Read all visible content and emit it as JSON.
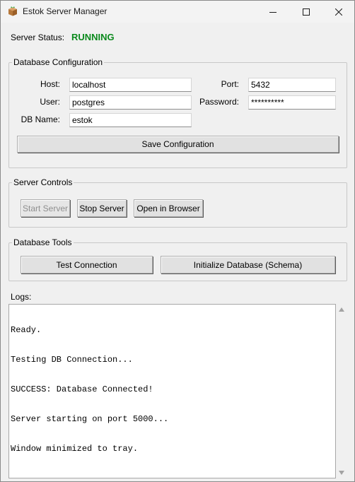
{
  "window": {
    "title": "Estok Server Manager",
    "icon": "box-package-icon"
  },
  "status": {
    "label": "Server Status:",
    "value": "RUNNING",
    "color": "#0b8a1d"
  },
  "db_config": {
    "title": "Database Configuration",
    "host_label": "Host:",
    "host_value": "localhost",
    "port_label": "Port:",
    "port_value": "5432",
    "user_label": "User:",
    "user_value": "postgres",
    "password_label": "Password:",
    "password_value": "**********",
    "dbname_label": "DB Name:",
    "dbname_value": "estok",
    "save_label": "Save Configuration"
  },
  "server_controls": {
    "title": "Server Controls",
    "start_label": "Start Server",
    "stop_label": "Stop Server",
    "open_label": "Open in Browser"
  },
  "db_tools": {
    "title": "Database Tools",
    "test_label": "Test Connection",
    "init_label": "Initialize Database (Schema)"
  },
  "logs": {
    "label": "Logs:",
    "lines": [
      "Ready.",
      "Testing DB Connection...",
      "SUCCESS: Database Connected!",
      "Server starting on port 5000...",
      "Window minimized to tray."
    ]
  }
}
